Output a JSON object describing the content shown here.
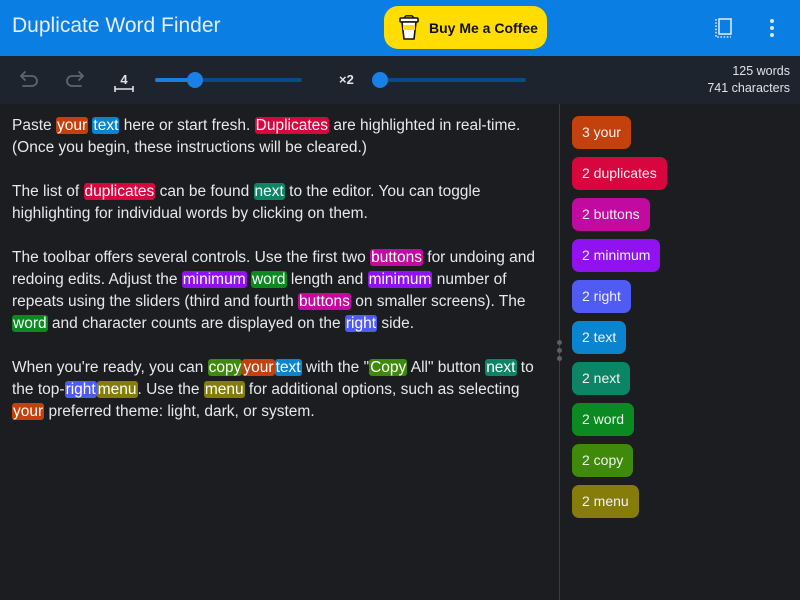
{
  "header": {
    "title": "Duplicate Word Finder",
    "coffee_label": "Buy Me a Coffee",
    "icons": [
      "coffee-cup-icon",
      "sidebar-toggle-icon",
      "more-vert-icon"
    ]
  },
  "toolbar": {
    "undo_icon": "undo-icon",
    "redo_icon": "redo-icon",
    "min_length_value": "4",
    "min_length_slider_fraction": 0.27,
    "min_repeats_label": "×2",
    "min_repeats_slider_fraction": 0.0,
    "word_count": "125 words",
    "char_count": "741 characters"
  },
  "editor": {
    "paragraphs": [
      [
        {
          "t": "Paste "
        },
        {
          "t": "your",
          "c": "#c2410c"
        },
        {
          "t": " "
        },
        {
          "t": "text",
          "c": "#0b84cf"
        },
        {
          "t": " here or start fresh. "
        },
        {
          "t": "Duplicates",
          "c": "#d8063f"
        },
        {
          "t": " are highlighted in real-time. (Once you begin, these instructions will be cleared.)"
        }
      ],
      [
        {
          "t": "The list of "
        },
        {
          "t": "duplicates",
          "c": "#d8063f"
        },
        {
          "t": " can be found "
        },
        {
          "t": "next",
          "c": "#0b8566"
        },
        {
          "t": " to the editor. You can toggle highlighting for individual words by clicking on them."
        }
      ],
      [
        {
          "t": "The toolbar offers several controls. Use the first two "
        },
        {
          "t": "buttons",
          "c": "#c30aa0"
        },
        {
          "t": " for undoing and redoing edits. Adjust the "
        },
        {
          "t": "minimum",
          "c": "#9012f0"
        },
        {
          "t": " "
        },
        {
          "t": "word",
          "c": "#0a8a20"
        },
        {
          "t": " length and "
        },
        {
          "t": "minimum",
          "c": "#9012f0"
        },
        {
          "t": " number of repeats using the sliders (third and fourth "
        },
        {
          "t": "buttons",
          "c": "#c30aa0"
        },
        {
          "t": " on smaller screens). The "
        },
        {
          "t": "word",
          "c": "#0a8a20"
        },
        {
          "t": " and character counts are displayed on the "
        },
        {
          "t": "right",
          "c": "#4f5bf2"
        },
        {
          "t": " side."
        }
      ],
      [
        {
          "t": "When you're ready, you can "
        },
        {
          "t": "copy",
          "c": "#3f8a0a"
        },
        {
          "t": "your",
          "c": "#c2410c"
        },
        {
          "t": "text",
          "c": "#0b84cf"
        },
        {
          "t": " with the \""
        },
        {
          "t": "Copy",
          "c": "#3f8a0a"
        },
        {
          "t": " All\" button "
        },
        {
          "t": "next",
          "c": "#0b8566"
        },
        {
          "t": " to the top-"
        },
        {
          "t": "right",
          "c": "#4f5bf2"
        },
        {
          "t": "menu",
          "c": "#857c0a"
        },
        {
          "t": ". Use the "
        },
        {
          "t": "menu",
          "c": "#857c0a"
        },
        {
          "t": " for additional options, such as selecting "
        },
        {
          "t": "your",
          "c": "#c2410c"
        },
        {
          "t": " preferred theme: light, dark, or system."
        }
      ]
    ]
  },
  "sidebar": {
    "duplicates": [
      {
        "label": "3 your",
        "color": "#c2410c"
      },
      {
        "label": "2 duplicates",
        "color": "#d8063f"
      },
      {
        "label": "2 buttons",
        "color": "#c30aa0"
      },
      {
        "label": "2 minimum",
        "color": "#9012f0"
      },
      {
        "label": "2 right",
        "color": "#4f5bf2"
      },
      {
        "label": "2 text",
        "color": "#0b84cf"
      },
      {
        "label": "2 next",
        "color": "#0b8566"
      },
      {
        "label": "2 word",
        "color": "#0a8a20"
      },
      {
        "label": "2 copy",
        "color": "#3f8a0a"
      },
      {
        "label": "2 menu",
        "color": "#857c0a"
      }
    ]
  }
}
